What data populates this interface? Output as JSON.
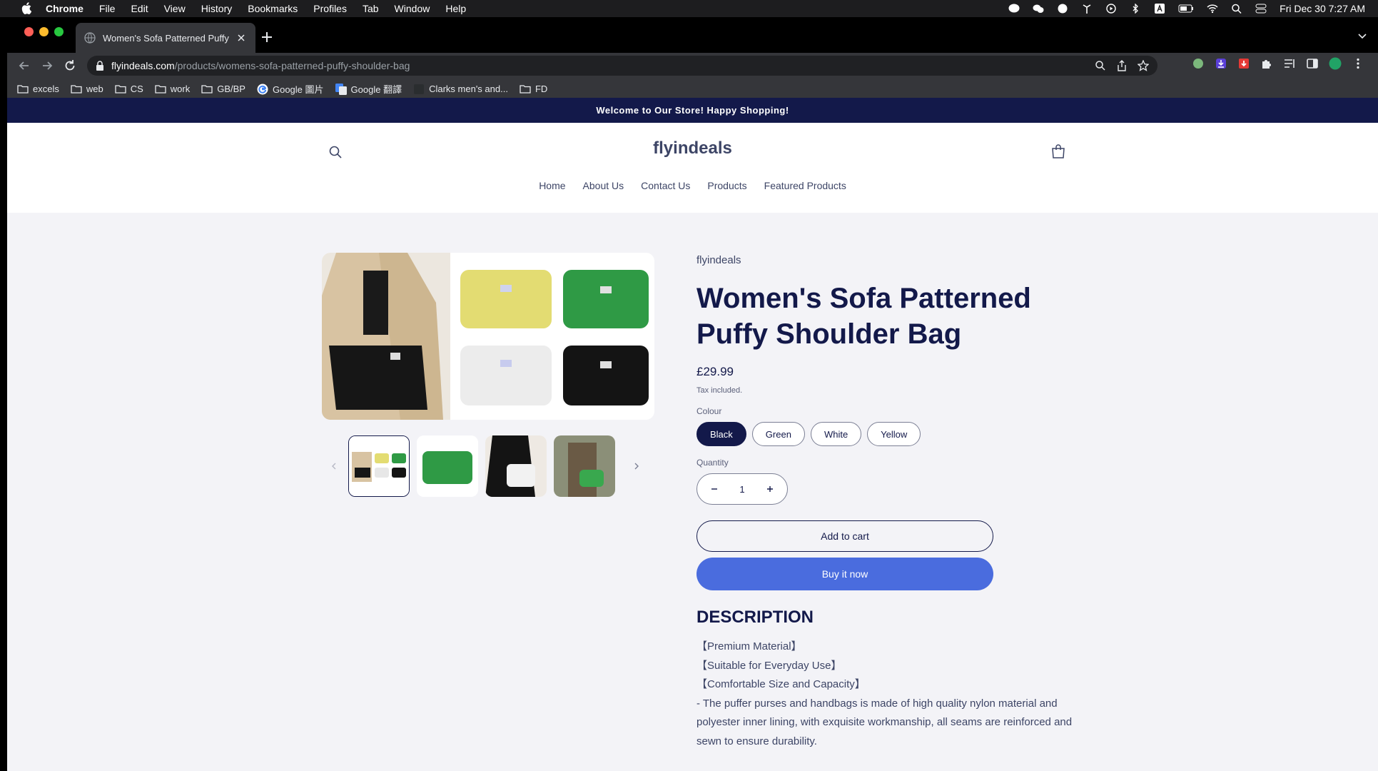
{
  "menubar": {
    "app": "Chrome",
    "items": [
      "File",
      "Edit",
      "View",
      "History",
      "Bookmarks",
      "Profiles",
      "Tab",
      "Window",
      "Help"
    ],
    "clock": "Fri Dec 30  7:27 AM"
  },
  "browser": {
    "tab_title": "Women's Sofa Patterned Puffy Shoulder Bag",
    "url_host": "flyindeals.com",
    "url_path": "/products/womens-sofa-patterned-puffy-shoulder-bag",
    "bookmarks": [
      {
        "label": "excels",
        "icon": "folder-icon"
      },
      {
        "label": "web",
        "icon": "folder-icon"
      },
      {
        "label": "CS",
        "icon": "folder-icon"
      },
      {
        "label": "work",
        "icon": "folder-icon"
      },
      {
        "label": "GB/BP",
        "icon": "folder-icon"
      },
      {
        "label": "Google 圖片",
        "icon": "google-icon"
      },
      {
        "label": "Google 翻譯",
        "icon": "translate-icon"
      },
      {
        "label": "Clarks men's and...",
        "icon": "site-icon"
      },
      {
        "label": "FD",
        "icon": "folder-icon"
      }
    ]
  },
  "store": {
    "announcement": "Welcome to Our Store! Happy Shopping!",
    "logo": "flyindeals",
    "nav": [
      "Home",
      "About Us",
      "Contact Us",
      "Products",
      "Featured Products"
    ]
  },
  "product": {
    "vendor": "flyindeals",
    "title": "Women's Sofa Patterned Puffy Shoulder Bag",
    "price": "£29.99",
    "tax_note": "Tax included.",
    "colour_label": "Colour",
    "colours": [
      "Black",
      "Green",
      "White",
      "Yellow"
    ],
    "selected_colour": "Black",
    "quantity_label": "Quantity",
    "quantity": "1",
    "add_to_cart": "Add to cart",
    "buy_now": "Buy it now",
    "description_heading": "DESCRIPTION",
    "description_lines": [
      "【Premium Material】",
      "【Suitable for Everyday Use】",
      "【Comfortable Size and Capacity】",
      "- The puffer purses and handbags is made of high quality nylon material and polyester inner lining, with exquisite workmanship, all seams are reinforced and sewn to ensure durability."
    ]
  }
}
